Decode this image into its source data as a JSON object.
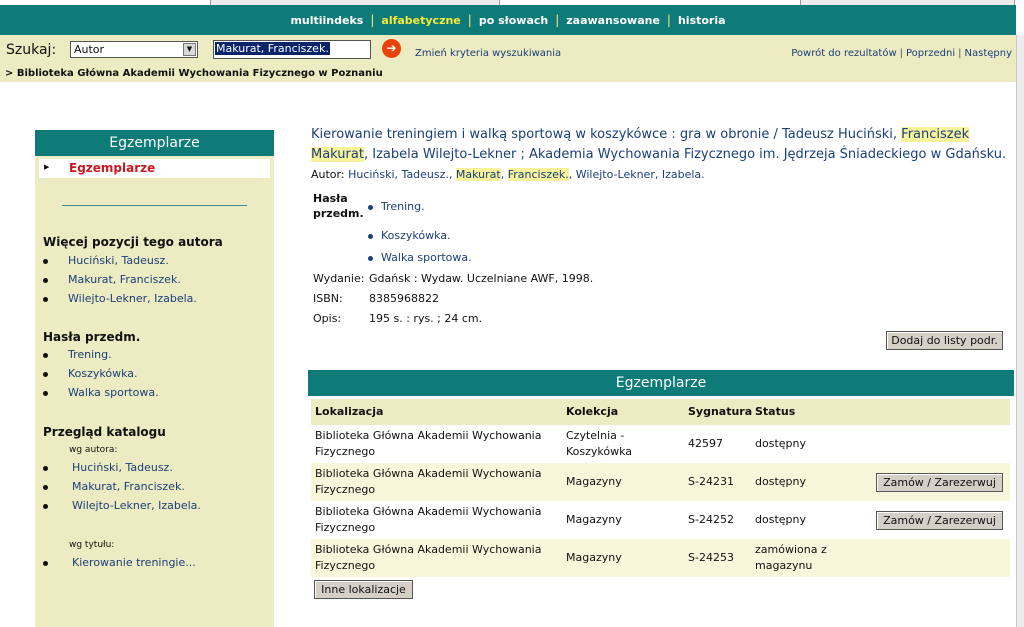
{
  "nav": {
    "items": [
      {
        "label": "multiindeks",
        "active": false
      },
      {
        "label": "alfabetyczne",
        "active": true
      },
      {
        "label": "po słowach",
        "active": false
      },
      {
        "label": "zaawansowane",
        "active": false
      },
      {
        "label": "historia",
        "active": false
      }
    ]
  },
  "search": {
    "label": "Szukaj:",
    "field_option": "Autor",
    "query": "Makurat, Franciszek.",
    "change_criteria": "Zmień kryteria wyszukiwania",
    "links": [
      "Powrót do rezultatów",
      "Poprzedni",
      "Następny"
    ]
  },
  "breadcrumb": "> Biblioteka Główna Akademii Wychowania Fizycznego w Poznaniu",
  "sidebar": {
    "title": "Egzemplarze",
    "selected": "Egzemplarze",
    "more_by_author": {
      "heading": "Więcej pozycji tego autora",
      "items": [
        "Huciński, Tadeusz.",
        "Makurat, Franciszek.",
        "Wilejto-Lekner, Izabela."
      ]
    },
    "subjects": {
      "heading": "Hasła przedm.",
      "items": [
        "Trening.",
        "Koszykówka.",
        "Walka sportowa."
      ]
    },
    "catalog": {
      "heading": "Przegląd katalogu",
      "by_author_label": "wg autora:",
      "authors": [
        "Huciński, Tadeusz.",
        "Makurat, Franciszek.",
        "Wilejto-Lekner, Izabela."
      ],
      "by_title_label": "wg tytułu:",
      "titles": [
        "Kierowanie treningie..."
      ]
    }
  },
  "record": {
    "title_parts": [
      "Kierowanie treningiem i walką sportową w koszykówce : gra w obronie / Tadeusz Huciński, ",
      "Franciszek",
      " ",
      "Makurat",
      ", Izabela Wilejto-Lekner ; Akademia Wychowania Fizycznego im. Jędrzeja Śniadeckiego w Gdańsku."
    ],
    "author_label": "Autor:",
    "authors_parts": [
      "Huciński, Tadeusz., ",
      "Makurat",
      ", ",
      "Franciszek.",
      ", Wilejto-Lekner, Izabela."
    ],
    "subjects_label": "Hasła przedm.",
    "subjects": [
      "Trening.",
      "Koszykówka.",
      "Walka sportowa."
    ],
    "edition_label": "Wydanie:",
    "edition": "Gdańsk : Wydaw. Uczelniane AWF, 1998.",
    "isbn_label": "ISBN:",
    "isbn": "8385968822",
    "desc_label": "Opis:",
    "desc": "195 s. : rys. ; 24 cm.",
    "add_button": "Dodaj do listy podr."
  },
  "holdings": {
    "title": "Egzemplarze",
    "headers": [
      "Lokalizacja",
      "Kolekcja",
      "Sygnatura",
      "Status"
    ],
    "rows": [
      {
        "loc": "Biblioteka Główna Akademii Wychowania Fizycznego",
        "coll": "Czytelnia - Koszykówka",
        "sig": "42597",
        "status": "dostępny",
        "action": ""
      },
      {
        "loc": "Biblioteka Główna Akademii Wychowania Fizycznego",
        "coll": "Magazyny",
        "sig": "S-24231",
        "status": "dostępny",
        "action": "Zamów / Zarezerwuj"
      },
      {
        "loc": "Biblioteka Główna Akademii Wychowania Fizycznego",
        "coll": "Magazyny",
        "sig": "S-24252",
        "status": "dostępny",
        "action": "Zamów / Zarezerwuj"
      },
      {
        "loc": "Biblioteka Główna Akademii Wychowania Fizycznego",
        "coll": "Magazyny",
        "sig": "S-24253",
        "status": "zamówiona z magazynu",
        "action": ""
      }
    ],
    "other_locations": "Inne lokalizacje"
  }
}
